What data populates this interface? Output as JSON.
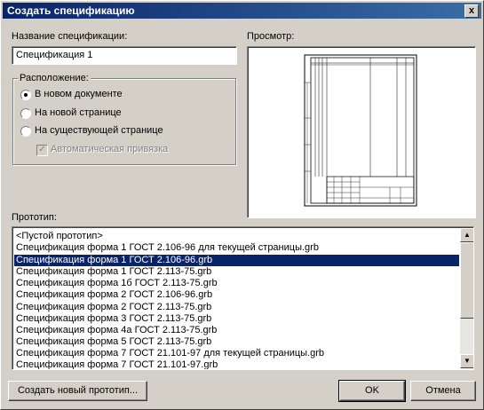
{
  "window": {
    "title": "Создать спецификацию",
    "close_glyph": "x"
  },
  "name_section": {
    "label": "Название спецификации:",
    "value": "Спецификация 1"
  },
  "location": {
    "label": "Расположение:",
    "options": [
      "В новом документе",
      "На новой странице",
      "На существующей странице"
    ],
    "selected_index": 0,
    "auto_bind": {
      "label": "Автоматическая привязка",
      "checked": true,
      "enabled": false
    }
  },
  "preview": {
    "label": "Просмотр:"
  },
  "prototype": {
    "label": "Прототип:",
    "items": [
      "<Пустой прототип>",
      "Спецификация форма 1 ГОСТ 2.106-96 для текущей страницы.grb",
      "Спецификация форма 1 ГОСТ 2.106-96.grb",
      "Спецификация форма 1 ГОСТ 2.113-75.grb",
      "Спецификация форма 1б ГОСТ 2.113-75.grb",
      "Спецификация форма 2 ГОСТ 2.106-96.grb",
      "Спецификация форма 2 ГОСТ 2.113-75.grb",
      "Спецификация форма 3 ГОСТ 2.113-75.grb",
      "Спецификация форма 4а ГОСТ 2.113-75.grb",
      "Спецификация форма 5 ГОСТ 2.113-75.grb",
      "Спецификация форма 7 ГОСТ 21.101-97 для текущей страницы.grb",
      "Спецификация форма 7 ГОСТ 21.101-97.grb"
    ],
    "selected_index": 2
  },
  "buttons": {
    "create_prototype": "Создать новый прототип...",
    "ok": "OK",
    "cancel": "Отмена"
  },
  "colors": {
    "selection": "#0a246a",
    "title_start": "#0a246a",
    "title_end": "#3a6ea5",
    "face": "#d4d0c8"
  }
}
